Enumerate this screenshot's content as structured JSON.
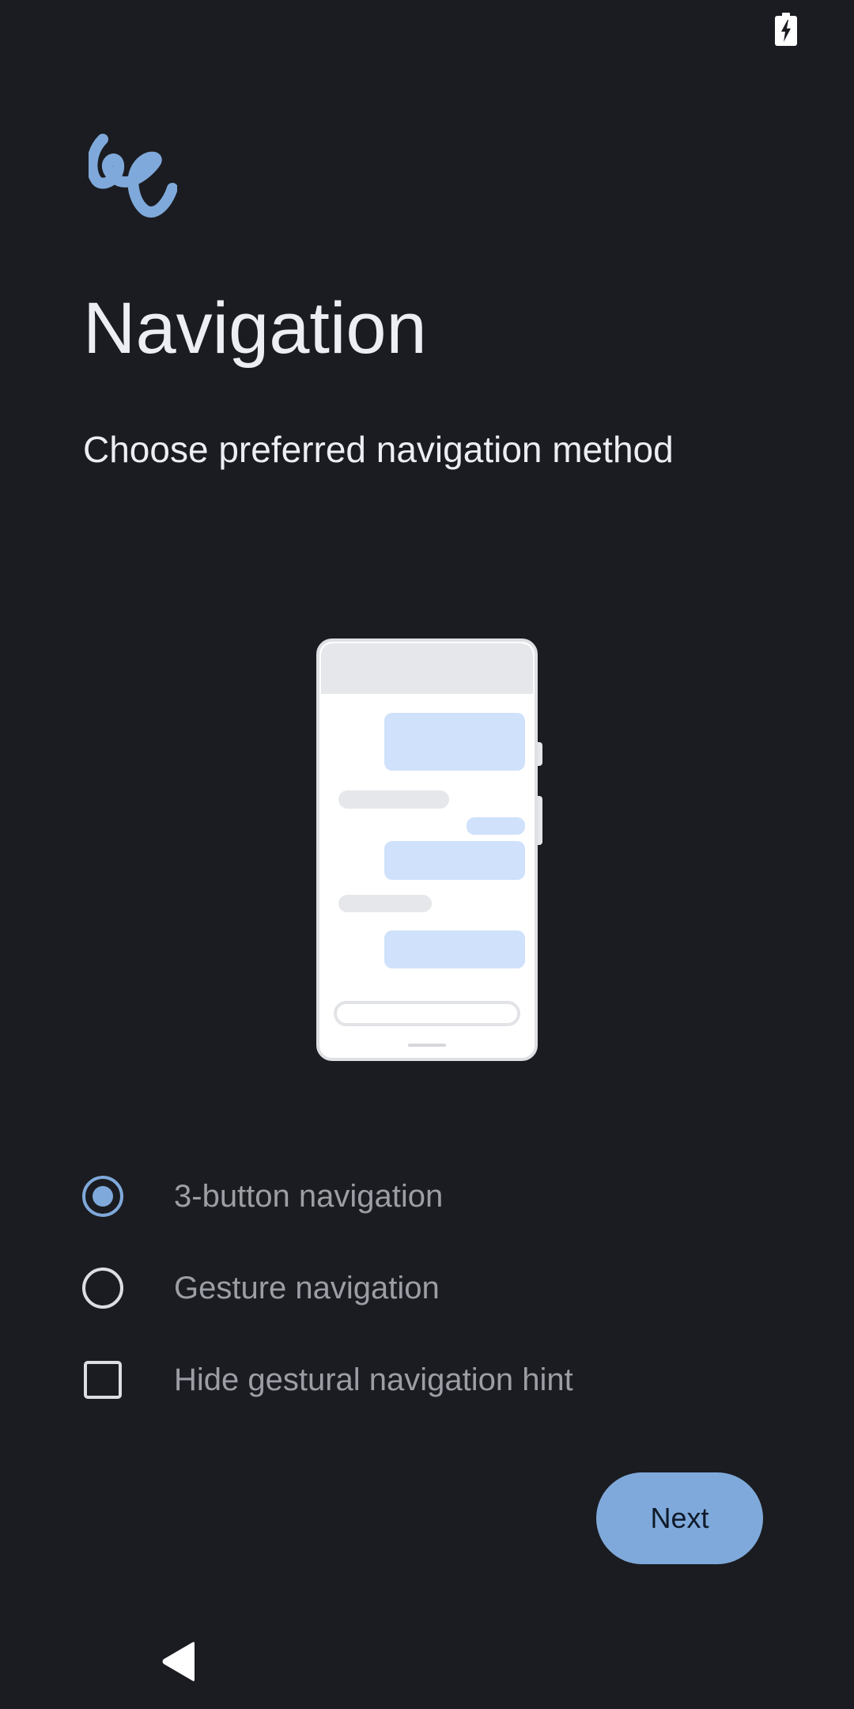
{
  "status_bar": {
    "battery_icon": "battery-charging-icon"
  },
  "logo": {
    "icon": "squiggle-logo-icon",
    "color": "#7fa9da"
  },
  "header": {
    "title": "Navigation",
    "subtitle": "Choose preferred navigation method"
  },
  "illustration": {
    "icon": "phone-chat-illustration"
  },
  "options": [
    {
      "label": "3-button navigation",
      "type": "radio",
      "selected": true
    },
    {
      "label": "Gesture navigation",
      "type": "radio",
      "selected": false
    },
    {
      "label": "Hide gestural navigation hint",
      "type": "checkbox",
      "checked": false
    }
  ],
  "footer": {
    "next_label": "Next"
  },
  "nav_bar": {
    "back_icon": "back-triangle-icon"
  },
  "colors": {
    "background": "#1b1c21",
    "accent": "#7fa9da",
    "title_text": "#eceef4",
    "option_text": "#9c9ea6"
  }
}
